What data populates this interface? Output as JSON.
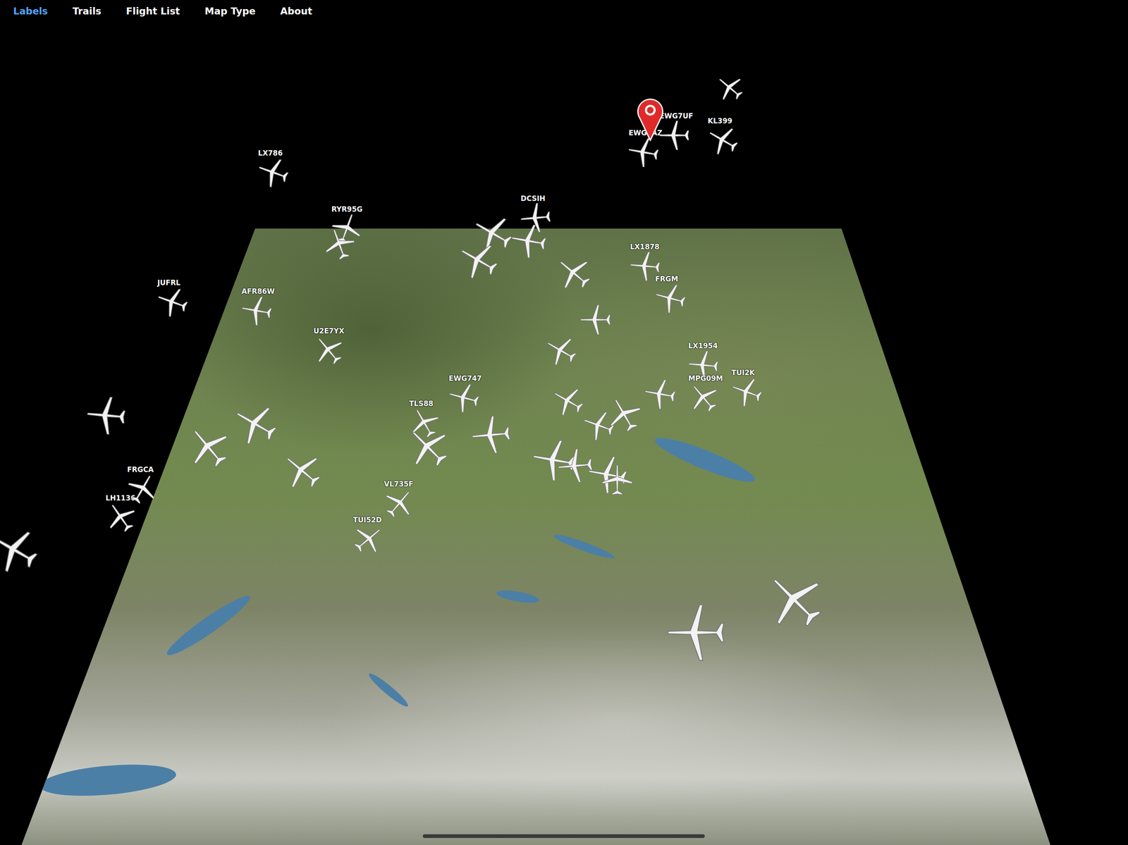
{
  "menu": [
    {
      "label": "Labels",
      "selected": true
    },
    {
      "label": "Trails",
      "selected": false
    },
    {
      "label": "Flight List",
      "selected": false
    },
    {
      "label": "Map Type",
      "selected": false
    },
    {
      "label": "About",
      "selected": false
    }
  ],
  "flights": [
    {
      "callsign": "LX786"
    },
    {
      "callsign": "EWG9AZ"
    },
    {
      "callsign": "EWG7UF"
    },
    {
      "callsign": "KL399"
    },
    {
      "callsign": "RYR95G"
    },
    {
      "callsign": "DCSIH"
    },
    {
      "callsign": "LX1878"
    },
    {
      "callsign": "FRGM"
    },
    {
      "callsign": "JUFRL"
    },
    {
      "callsign": "AFR86W"
    },
    {
      "callsign": "U2E7YX"
    },
    {
      "callsign": "LX1954"
    },
    {
      "callsign": "TUI2K"
    },
    {
      "callsign": "MPG09M"
    },
    {
      "callsign": "EWG747"
    },
    {
      "callsign": "TLS88"
    },
    {
      "callsign": "VL735F"
    },
    {
      "callsign": "TUI52D"
    },
    {
      "callsign": "LH1136"
    },
    {
      "callsign": "FRGCA"
    }
  ]
}
